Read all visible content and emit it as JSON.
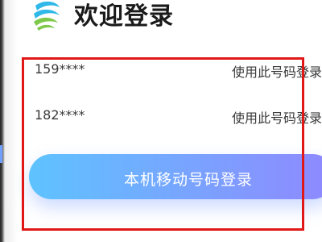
{
  "header": {
    "title": "欢迎登录",
    "logo_icon": "china-mobile-logo-icon",
    "logo_colors": [
      "#2fb8e8",
      "#7ec84a"
    ]
  },
  "accounts": [
    {
      "number": "159****",
      "action_label": "使用此号码登录"
    },
    {
      "number": "182****",
      "action_label": "使用此号码登录"
    }
  ],
  "login_button": {
    "label": "本机移动号码登录"
  },
  "highlight": {
    "color": "#e01818"
  }
}
